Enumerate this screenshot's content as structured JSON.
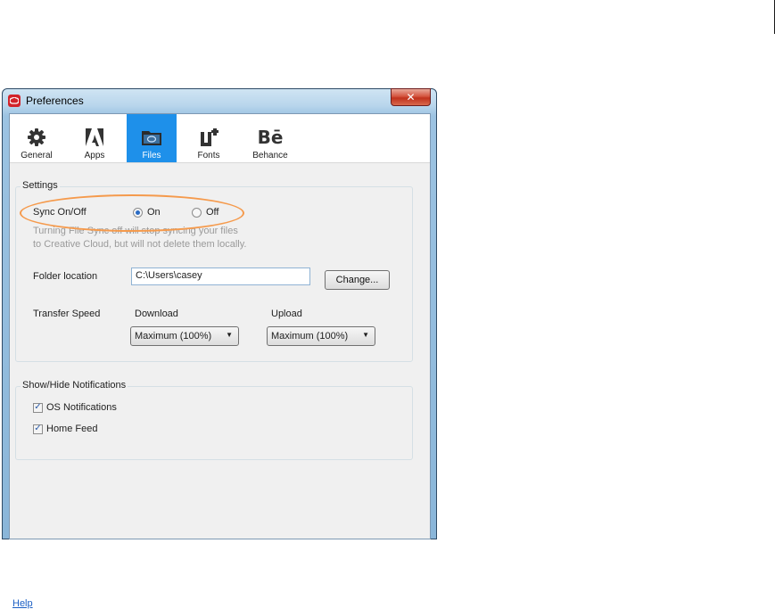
{
  "window": {
    "title": "Preferences",
    "close_glyph": "✕"
  },
  "tabs": [
    {
      "label": "General",
      "icon": "gear-icon"
    },
    {
      "label": "Apps",
      "icon": "adobe-logo-icon"
    },
    {
      "label": "Files",
      "icon": "folder-icon",
      "active": true
    },
    {
      "label": "Fonts",
      "icon": "fonts-icon"
    },
    {
      "label": "Behance",
      "icon": "behance-logo-icon",
      "glyph": "Bē"
    }
  ],
  "settings": {
    "legend": "Settings",
    "sync_label": "Sync On/Off",
    "sync_on_label": "On",
    "sync_off_label": "Off",
    "sync_value": "On",
    "sync_note_line1": "Turning File Sync off will stop syncing your files",
    "sync_note_line2": "to Creative Cloud, but will not delete them locally.",
    "folder_label": "Folder location",
    "folder_value": "C:\\Users\\casey",
    "change_button": "Change...",
    "transfer_label": "Transfer Speed",
    "download_label": "Download",
    "upload_label": "Upload",
    "download_value": "Maximum (100%)",
    "upload_value": "Maximum (100%)"
  },
  "notifications": {
    "legend": "Show/Hide Notifications",
    "os_label": "OS Notifications",
    "os_checked": true,
    "home_label": "Home Feed",
    "home_checked": true
  },
  "help_link": "Help",
  "colors": {
    "accent": "#1e90ea",
    "highlight": "#f59a4c",
    "title_icon": "#d2232a"
  }
}
